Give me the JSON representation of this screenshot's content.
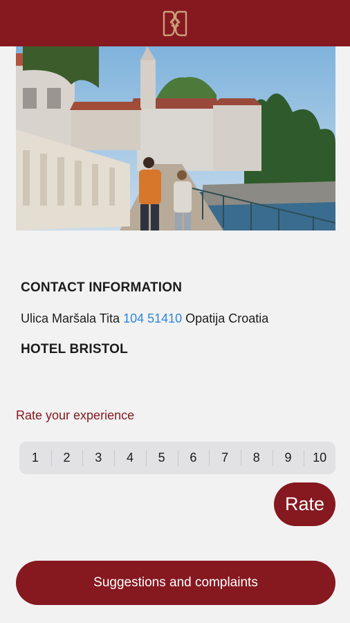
{
  "header": {
    "logo_icon": "hotel-monogram-logo",
    "bar_color": "#861820"
  },
  "hero": {
    "image": "photo of couple walking along seaside promenade with church in Opatija"
  },
  "contact": {
    "title": "CONTACT INFORMATION",
    "street": "Ulica Maršala Tita",
    "phone": "104 51410",
    "city": "Opatija Croatia",
    "hotel_name": "HOTEL BRISTOL"
  },
  "rating": {
    "label": "Rate your experience",
    "options": [
      "1",
      "2",
      "3",
      "4",
      "5",
      "6",
      "7",
      "8",
      "9",
      "10"
    ],
    "rate_button": "Rate"
  },
  "suggestions_button": "Suggestions and complaints",
  "colors": {
    "brand": "#861820",
    "link": "#2f86dc",
    "background": "#f2f2f2"
  }
}
